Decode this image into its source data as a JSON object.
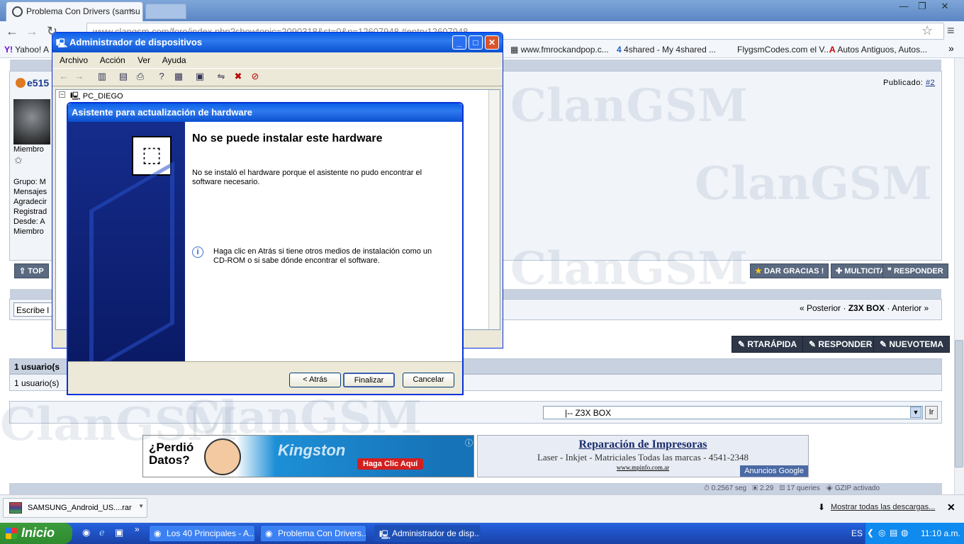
{
  "browser": {
    "tab_title": "Problema Con Drivers (samsu",
    "tab_close": "×",
    "url": "www.clangsm.com/foro/index.php?showtopic=2090318&st=0&p=12607948 #entry12607948",
    "win_controls": [
      "—",
      "❐",
      "✕"
    ]
  },
  "bookmarks": [
    "Yahoo! A",
    "www.fmrockandpop.c...",
    "4shared - My 4shared ...",
    "FlygsmCodes.com el V...",
    "Autos Antiguos, Autos..."
  ],
  "post": {
    "username": "e515",
    "published_label": "Publicado:",
    "published_num": "#2",
    "member_label": "Miembro",
    "profile_lines": [
      "Grupo: M",
      "Mensajes",
      "Agradecir",
      "Registrad",
      "Desde: A",
      "Miembro"
    ],
    "top_button": "TOP",
    "thanks_button": "DAR GRACIAS !",
    "multicita_button": "MULTICITA",
    "responder_small": "RESPONDER",
    "search_placeholder": "Escribe l",
    "nav": {
      "prev": "« Posterior",
      "sep1": "·",
      "current": "Z3X BOX",
      "sep2": "·",
      "next": "Anterior »"
    },
    "fast_reply": "RTARÁPIDA",
    "reply": "RESPONDER",
    "new_topic": "NUEVOTEMA",
    "users_header": "1 usuario(s",
    "users_line": "1 usuario(s)",
    "forum_select": "|-- Z3X BOX",
    "go_button": "Ir"
  },
  "ads": {
    "ad1_text": "¿Perdió Datos?",
    "ad1_brand": "Kingston",
    "ad1_cta": "Haga Clic Aquí",
    "ad2_title": "Reparación de Impresoras",
    "ad2_line": "Laser - Inkjet - Matriciales Todas las marcas - 4541-2348",
    "ad2_url": "www.mpinfo.com.ar",
    "ad2_badge": "Anuncios Google"
  },
  "footer_stats": {
    "time": "0.2567 seg",
    "load": "2.29",
    "queries": "17 queries",
    "gzip": "GZIP activado"
  },
  "devmgr": {
    "title": "Administrador de dispositivos",
    "menu": [
      "Archivo",
      "Acción",
      "Ver",
      "Ayuda"
    ],
    "tree_root": "PC_DIEGO",
    "tree_toggle": "−"
  },
  "wizard": {
    "title": "Asistente para actualización de hardware",
    "heading": "No se puede instalar este hardware",
    "message": "No se instaló el hardware porque el asistente no pudo encontrar el software necesario.",
    "info": "Haga clic en Atrás si tiene otros medios de instalación como un CD-ROM o si sabe dónde encontrar el software.",
    "back": "< Atrás",
    "finish": "Finalizar",
    "cancel": "Cancelar"
  },
  "downloads": {
    "file": "SAMSUNG_Android_US....rar",
    "show_all": "Mostrar todas las descargas...",
    "close": "✕"
  },
  "taskbar": {
    "start": "Inicio",
    "tasks": [
      "Los 40 Principales - A...",
      "Problema Con Drivers...",
      "Administrador de disp..."
    ],
    "lang": "ES",
    "time": "11:10 a.m."
  },
  "watermark": "ClanGSM"
}
